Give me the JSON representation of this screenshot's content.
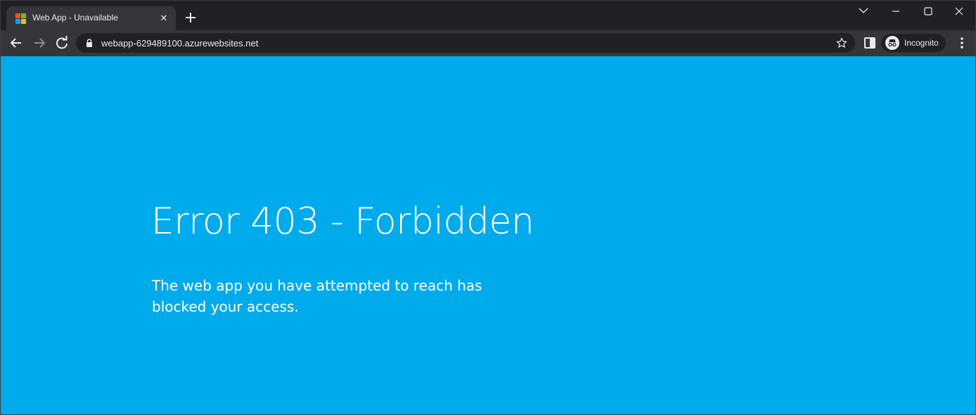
{
  "browser": {
    "tab": {
      "title": "Web App - Unavailable",
      "favicon": "microsoft-logo",
      "close_glyph": "✕"
    },
    "address_bar": {
      "url": "webapp-629489100.azurewebsites.net"
    },
    "profile": {
      "label": "Incognito"
    },
    "colors": {
      "frame": "#202124",
      "toolbar": "#35363a",
      "text": "#e8eaed"
    }
  },
  "page": {
    "background": "#00abec",
    "title": "Error 403 - Forbidden",
    "description": "The web app you have attempted to reach has blocked your access."
  }
}
